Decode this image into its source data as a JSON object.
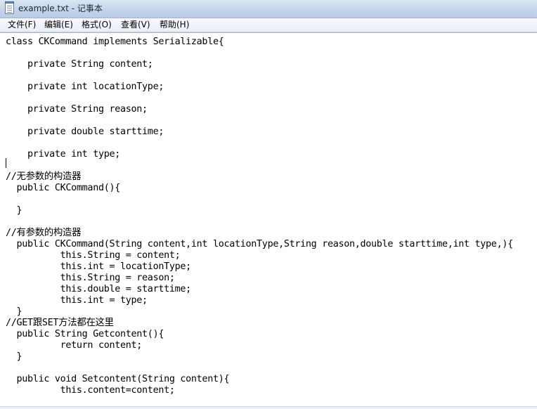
{
  "window": {
    "title": "example.txt - 记事本"
  },
  "menu": {
    "items": [
      "文件(F)",
      "编辑(E)",
      "格式(O)",
      "查看(V)",
      "帮助(H)"
    ]
  },
  "editor": {
    "lines": [
      "class CKCommand implements Serializable{",
      "",
      "    private String content;",
      "",
      "    private int locationType;",
      "",
      "    private String reason;",
      "",
      "    private double starttime;",
      "",
      "    private int type;",
      "",
      "//无参数的构造器",
      "  public CKCommand(){",
      "",
      "  }",
      "",
      "//有参数的构造器",
      "  public CKCommand(String content,int locationType,String reason,double starttime,int type,){",
      "          this.String = content;",
      "          this.int = locationType;",
      "          this.String = reason;",
      "          this.double = starttime;",
      "          this.int = type;",
      "  }",
      "//GET跟SET方法都在这里",
      "  public String Getcontent(){",
      "          return content;",
      "  }",
      "",
      "  public void Setcontent(String content){",
      "          this.content=content;"
    ]
  },
  "icons": {
    "app": "notepad-icon"
  }
}
